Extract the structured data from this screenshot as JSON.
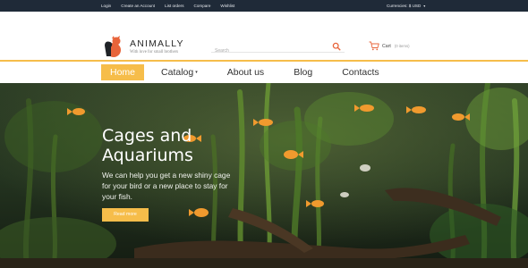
{
  "topbar": {
    "links": [
      "Login",
      "Create an Account",
      "List orders",
      "Compare",
      "Wishlist"
    ],
    "currency_label": "Currencies: $ USD"
  },
  "header": {
    "logo_name": "ANIMALLY",
    "logo_tagline": "With love for small brothers",
    "search_placeholder": "Search",
    "cart_label": "Cart",
    "cart_count": "(0 items)"
  },
  "nav": {
    "items": [
      {
        "label": "Home",
        "active": true
      },
      {
        "label": "Catalog",
        "active": false
      },
      {
        "label": "About us",
        "active": false
      },
      {
        "label": "Blog",
        "active": false
      },
      {
        "label": "Contacts",
        "active": false
      }
    ]
  },
  "hero": {
    "title": "Cages and Aquariums",
    "text": "We can help you get a new shiny cage for your bird or a new place to stay for your fish.",
    "button_label": "Read more"
  },
  "colors": {
    "accent": "#f6bd4a",
    "topbar": "#1f2a38",
    "logo_orange": "#e8643a"
  }
}
